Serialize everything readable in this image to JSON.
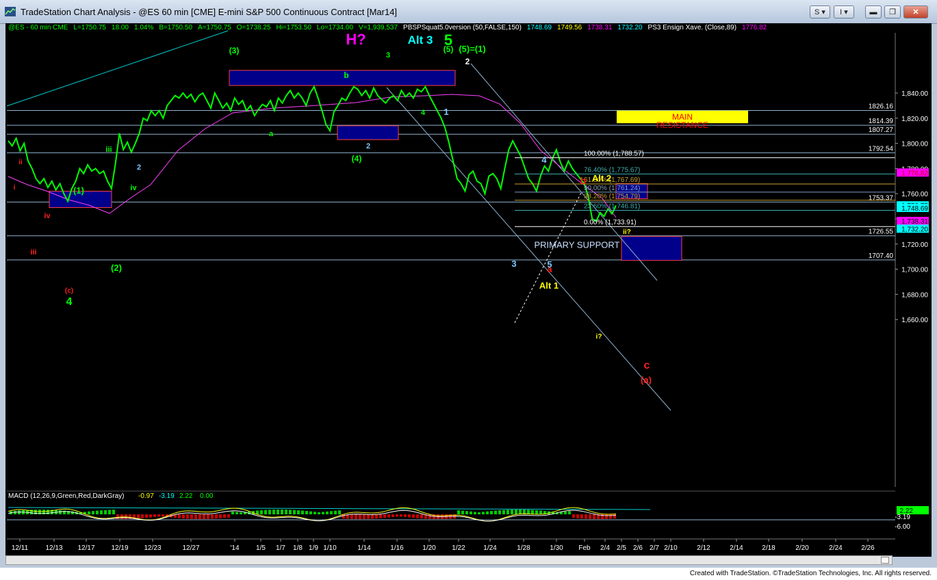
{
  "window": {
    "title": "TradeStation Chart Analysis - @ES 60 min [CME] E-mini S&P 500 Continuous Contract [Mar14]",
    "buttons": [
      "S",
      "I"
    ],
    "colors": {
      "title_bar": "#c8d6ea",
      "close": "#c1402a"
    }
  },
  "status_line": {
    "items": [
      {
        "text": "@ES - 60 min  CME",
        "color": "#00ff00"
      },
      {
        "text": "L=1750.75",
        "color": "#00ff00"
      },
      {
        "text": "18.00",
        "color": "#00ff00"
      },
      {
        "text": "1.04%",
        "color": "#00ff00"
      },
      {
        "text": "B=1750.50",
        "color": "#00ff00"
      },
      {
        "text": "A=1750.75",
        "color": "#00ff00"
      },
      {
        "text": "O=1738.25",
        "color": "#00ff00"
      },
      {
        "text": "Hi=1753.50",
        "color": "#00ff00"
      },
      {
        "text": "Lo=1734.00",
        "color": "#00ff00"
      },
      {
        "text": "V=1,939,537",
        "color": "#00ff00"
      },
      {
        "text": "PBSPSquat5.0version (50,FALSE,150)",
        "color": "#ffffff"
      },
      {
        "text": "1748.69",
        "color": "#00ffff"
      },
      {
        "text": "1749.56",
        "color": "#ffff00"
      },
      {
        "text": "1738.31",
        "color": "#ff00ff"
      },
      {
        "text": "1732.20",
        "color": "#00ffff"
      },
      {
        "text": "PS3 Ensign Xave. (Close,89)",
        "color": "#ffffff"
      },
      {
        "text": "1776.82",
        "color": "#ff00ff"
      }
    ]
  },
  "chart_data": {
    "type": "line",
    "title": "@ES 60 min",
    "y_axis": {
      "ticks": [
        "1,840.00",
        "1,820.00",
        "1,800.00",
        "1,780.00",
        "1,760.00",
        "1,740.00",
        "1,720.00",
        "1,700.00",
        "1,680.00",
        "1,660.00"
      ],
      "tick_values": [
        1840,
        1820,
        1800,
        1780,
        1760,
        1740,
        1720,
        1700,
        1680,
        1660
      ],
      "range": [
        1648,
        1860
      ]
    },
    "x_axis": {
      "ticks": [
        "12/11",
        "12/13",
        "12/17",
        "12/19",
        "12/23",
        "12/27",
        "'14",
        "1/5",
        "1/7",
        "1/8",
        "1/9",
        "1/10",
        "1/14",
        "1/16",
        "1/20",
        "1/22",
        "1/24",
        "1/28",
        "1/30",
        "Feb",
        "2/4",
        "2/5",
        "2/6",
        "2/7",
        "2/10",
        "2/12",
        "2/14",
        "2/18",
        "2/20",
        "2/24",
        "2/26"
      ]
    },
    "price_path": [
      1802,
      1798,
      1804,
      1794,
      1800,
      1786,
      1780,
      1772,
      1768,
      1772,
      1765,
      1770,
      1763,
      1768,
      1760,
      1754,
      1764,
      1770,
      1780,
      1776,
      1783,
      1778,
      1780,
      1776,
      1778,
      1770,
      1764,
      1784,
      1808,
      1795,
      1801,
      1793,
      1800,
      1808,
      1820,
      1818,
      1826,
      1822,
      1826,
      1820,
      1830,
      1834,
      1838,
      1836,
      1840,
      1836,
      1839,
      1833,
      1838,
      1840,
      1834,
      1828,
      1840,
      1834,
      1828,
      1832,
      1826,
      1836,
      1831,
      1834,
      1826,
      1830,
      1822,
      1827,
      1831,
      1829,
      1834,
      1826,
      1836,
      1832,
      1838,
      1842,
      1836,
      1840,
      1836,
      1830,
      1840,
      1845,
      1836,
      1826,
      1815,
      1810,
      1825,
      1830,
      1836,
      1834,
      1840,
      1845,
      1843,
      1838,
      1842,
      1836,
      1844,
      1838,
      1835,
      1832,
      1836,
      1838,
      1834,
      1842,
      1837,
      1840,
      1836,
      1843,
      1841,
      1845,
      1838,
      1832,
      1826,
      1820,
      1812,
      1800,
      1786,
      1772,
      1768,
      1762,
      1775,
      1778,
      1770,
      1768,
      1760,
      1774,
      1776,
      1772,
      1764,
      1780,
      1795,
      1802,
      1796,
      1790,
      1781,
      1772,
      1768,
      1762,
      1774,
      1782,
      1778,
      1788,
      1795,
      1785,
      1778,
      1786,
      1780,
      1776,
      1772,
      1768,
      1758,
      1740,
      1738,
      1745,
      1742,
      1748,
      1744,
      1750.75
    ],
    "horizontal_levels": [
      {
        "value": 1826.16,
        "label": "1826.16"
      },
      {
        "value": 1814.39,
        "label": "1814.39"
      },
      {
        "value": 1807.27,
        "label": "1807.27"
      },
      {
        "value": 1792.54,
        "label": "1792.54"
      },
      {
        "value": 1753.37,
        "label": "1753.37"
      },
      {
        "value": 1726.55,
        "label": "1726.55"
      },
      {
        "value": 1707.4,
        "label": "1707.40"
      }
    ],
    "fib_levels": [
      {
        "label": "100.00% (1,788.57)",
        "value": 1788.57,
        "color": "#ffffff"
      },
      {
        "label": "76.40% (1,775.67)",
        "value": 1775.67,
        "color": "#3fb0b0"
      },
      {
        "label": "61.80% (1,767.69)",
        "value": 1767.69,
        "color": "#c8a030"
      },
      {
        "label": "50.00% (1,761.24)",
        "value": 1761.24,
        "color": "#7fa0c0"
      },
      {
        "label": "38.20% (1,754.79)",
        "value": 1754.79,
        "color": "#c8a030"
      },
      {
        "label": "23.60% (1,746.81)",
        "value": 1746.81,
        "color": "#3fb0b0"
      },
      {
        "label": "0.00% (1,733.91)",
        "value": 1733.91,
        "color": "#ffffff"
      }
    ],
    "right_axis_tags": [
      {
        "text": "1,776.82",
        "value": 1776.82,
        "bg": "#ff00ff",
        "fg": "#cc0000"
      },
      {
        "text": "1,750.75",
        "value": 1750.75,
        "bg": "#00ffff",
        "fg": "#000000"
      },
      {
        "text": "1,748.69",
        "value": 1748.69,
        "bg": "#00ffff",
        "fg": "#000000"
      },
      {
        "text": "1,738.31",
        "value": 1738.31,
        "bg": "#ff00ff",
        "fg": "#000000"
      },
      {
        "text": "1,732.20",
        "value": 1732.2,
        "bg": "#00ffff",
        "fg": "#000000"
      }
    ],
    "zones": [
      {
        "label": "MAIN\nRESISTANCE",
        "kind": "resistance"
      },
      {
        "label": "PRIMARY SUPPORT",
        "kind": "support"
      }
    ],
    "macd": {
      "title": "MACD (12,26,9,Green,Red,DarkGray)",
      "values": [
        "-0.97",
        "-3.19",
        "2.22",
        "0.00"
      ],
      "value_colors": [
        "#ffff00",
        "#00ffff",
        "#00ff00",
        "#00ff00"
      ],
      "right_labels": [
        {
          "text": "2.22",
          "bg": "#00ff00"
        },
        {
          "text": "-3.19",
          "bg": ""
        },
        {
          "text": "-6.00",
          "bg": ""
        }
      ]
    },
    "wave_labels": [
      {
        "text": "H?",
        "color": "#ff00ff"
      },
      {
        "text": "Alt 3",
        "color": "#00ffff"
      },
      {
        "text": "5",
        "color": "#00ff00"
      },
      {
        "text": "(5)=(1)",
        "color": "#00ff00"
      },
      {
        "text": "(3)",
        "color": "#00ff00"
      },
      {
        "text": "(5)",
        "color": "#00ff00"
      },
      {
        "text": "3",
        "color": "#00ff00"
      },
      {
        "text": "2",
        "color": "#ffffff"
      },
      {
        "text": "1",
        "color": "#7fc8ff"
      },
      {
        "text": "4",
        "color": "#00ff00"
      },
      {
        "text": "b",
        "color": "#00ff00"
      },
      {
        "text": "2",
        "color": "#7fc8ff"
      },
      {
        "text": "(4)",
        "color": "#00ff00"
      },
      {
        "text": "a",
        "color": "#00ff00"
      },
      {
        "text": "4",
        "color": "#00ff00"
      },
      {
        "text": "(1)",
        "color": "#00ff00"
      },
      {
        "text": "(2)",
        "color": "#00ff00"
      },
      {
        "text": "iii",
        "color": "#00ff00"
      },
      {
        "text": "iv",
        "color": "#00ff00"
      },
      {
        "text": "2",
        "color": "#7fc8ff"
      },
      {
        "text": "4",
        "color": "#7fc8ff"
      },
      {
        "text": "b",
        "color": "#ff2020"
      },
      {
        "text": "Alt 2",
        "color": "#ffff00"
      },
      {
        "text": "Alt 1",
        "color": "#ffff00"
      },
      {
        "text": "3",
        "color": "#7fc8ff"
      },
      {
        "text": "5",
        "color": "#7fc8ff"
      },
      {
        "text": "a",
        "color": "#ff2020"
      },
      {
        "text": "c",
        "color": "#ff2020"
      },
      {
        "text": "(a)",
        "color": "#ff2020"
      },
      {
        "text": "ii?",
        "color": "#ffff00"
      },
      {
        "text": "i?",
        "color": "#ffff00"
      },
      {
        "text": "iii",
        "color": "#ff2020"
      },
      {
        "text": "ii",
        "color": "#ff2020"
      },
      {
        "text": "iv",
        "color": "#ff2020"
      },
      {
        "text": "i",
        "color": "#ff2020"
      },
      {
        "text": "(c)",
        "color": "#ff2020"
      }
    ]
  },
  "footer": {
    "credit": "Created with TradeStation. ©TradeStation Technologies, Inc. All rights reserved."
  }
}
